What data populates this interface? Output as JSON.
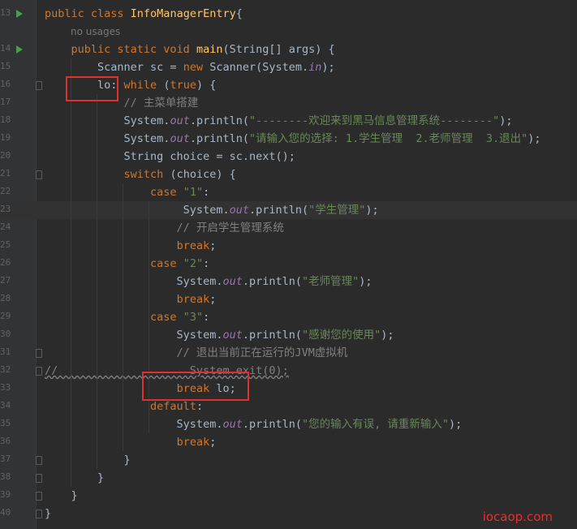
{
  "editor": {
    "watermark": "iocaop.com",
    "usage_hint": "no usages",
    "lines": [
      {
        "num": "13",
        "parts": [
          [
            "kw",
            "public class "
          ],
          [
            "fn",
            "InfoManagerEntry"
          ],
          [
            "",
            "{"
          ]
        ]
      },
      {
        "num": "14",
        "parts": [
          [
            "",
            "    "
          ],
          [
            "kw",
            "public static void "
          ],
          [
            "fn",
            "main"
          ],
          [
            "",
            "(String[] args) {"
          ]
        ]
      },
      {
        "num": "15",
        "parts": [
          [
            "",
            "        Scanner sc = "
          ],
          [
            "kw",
            "new "
          ],
          [
            "",
            "Scanner(System."
          ],
          [
            "fi",
            "in"
          ],
          [
            "",
            ");"
          ]
        ]
      },
      {
        "num": "16",
        "parts": [
          [
            "",
            "        lo: "
          ],
          [
            "kw",
            "while "
          ],
          [
            "",
            "("
          ],
          [
            "kw",
            "true"
          ],
          [
            "",
            ") {"
          ]
        ]
      },
      {
        "num": "17",
        "parts": [
          [
            "cm",
            "            // 主菜单搭建"
          ]
        ]
      },
      {
        "num": "18",
        "parts": [
          [
            "",
            "            System."
          ],
          [
            "fi",
            "out"
          ],
          [
            "",
            ".println("
          ],
          [
            "st",
            "\"--------欢迎来到黑马信息管理系统--------\""
          ],
          [
            "",
            ");"
          ]
        ]
      },
      {
        "num": "19",
        "parts": [
          [
            "",
            "            System."
          ],
          [
            "fi",
            "out"
          ],
          [
            "",
            ".println("
          ],
          [
            "st",
            "\"请输入您的选择: 1.学生管理  2.老师管理  3.退出\""
          ],
          [
            "",
            ");"
          ]
        ]
      },
      {
        "num": "20",
        "parts": [
          [
            "",
            "            String choice = sc.next();"
          ]
        ]
      },
      {
        "num": "21",
        "parts": [
          [
            "",
            "            "
          ],
          [
            "kw",
            "switch "
          ],
          [
            "",
            "(choice) {"
          ]
        ]
      },
      {
        "num": "22",
        "parts": [
          [
            "",
            "                "
          ],
          [
            "kw",
            "case "
          ],
          [
            "st",
            "\"1\""
          ],
          [
            "",
            ":"
          ]
        ]
      },
      {
        "num": "23",
        "parts": [
          [
            "",
            "                     System."
          ],
          [
            "fi",
            "out"
          ],
          [
            "",
            ".println("
          ],
          [
            "st",
            "\"学生管理\""
          ],
          [
            "",
            ");"
          ]
        ]
      },
      {
        "num": "24",
        "parts": [
          [
            "cm",
            "                    // 开启学生管理系统"
          ]
        ]
      },
      {
        "num": "25",
        "parts": [
          [
            "",
            "                    "
          ],
          [
            "kw",
            "break"
          ],
          [
            "",
            ";"
          ]
        ]
      },
      {
        "num": "26",
        "parts": [
          [
            "",
            "                "
          ],
          [
            "kw",
            "case "
          ],
          [
            "st",
            "\"2\""
          ],
          [
            "",
            ":"
          ]
        ]
      },
      {
        "num": "27",
        "parts": [
          [
            "",
            "                    System."
          ],
          [
            "fi",
            "out"
          ],
          [
            "",
            ".println("
          ],
          [
            "st",
            "\"老师管理\""
          ],
          [
            "",
            ");"
          ]
        ]
      },
      {
        "num": "28",
        "parts": [
          [
            "",
            "                    "
          ],
          [
            "kw",
            "break"
          ],
          [
            "",
            ";"
          ]
        ]
      },
      {
        "num": "29",
        "parts": [
          [
            "",
            "                "
          ],
          [
            "kw",
            "case "
          ],
          [
            "st",
            "\"3\""
          ],
          [
            "",
            ":"
          ]
        ]
      },
      {
        "num": "30",
        "parts": [
          [
            "",
            "                    System."
          ],
          [
            "fi",
            "out"
          ],
          [
            "",
            ".println("
          ],
          [
            "st",
            "\"感谢您的使用\""
          ],
          [
            "",
            ");"
          ]
        ]
      },
      {
        "num": "31",
        "parts": [
          [
            "cm",
            "                    // 退出当前正在运行的JVM虚拟机"
          ]
        ]
      },
      {
        "num": "32",
        "parts": [
          [
            "cmw",
            "//                    System.exit(0);"
          ]
        ]
      },
      {
        "num": "33",
        "parts": [
          [
            "",
            "                    "
          ],
          [
            "kw",
            "break "
          ],
          [
            "",
            "lo;"
          ]
        ]
      },
      {
        "num": "34",
        "parts": [
          [
            "",
            "                "
          ],
          [
            "kw",
            "default"
          ],
          [
            "",
            ":"
          ]
        ]
      },
      {
        "num": "35",
        "parts": [
          [
            "",
            "                    System."
          ],
          [
            "fi",
            "out"
          ],
          [
            "",
            ".println("
          ],
          [
            "st",
            "\"您的输入有误, 请重新输入\""
          ],
          [
            "",
            ");"
          ]
        ]
      },
      {
        "num": "36",
        "parts": [
          [
            "",
            "                    "
          ],
          [
            "kw",
            "break"
          ],
          [
            "",
            ";"
          ]
        ]
      },
      {
        "num": "37",
        "parts": [
          [
            "",
            "            }"
          ]
        ]
      },
      {
        "num": "38",
        "parts": [
          [
            "",
            "        }"
          ]
        ]
      },
      {
        "num": "39",
        "parts": [
          [
            "",
            "    }"
          ]
        ]
      },
      {
        "num": "40",
        "parts": [
          [
            "",
            "}"
          ]
        ]
      }
    ]
  }
}
